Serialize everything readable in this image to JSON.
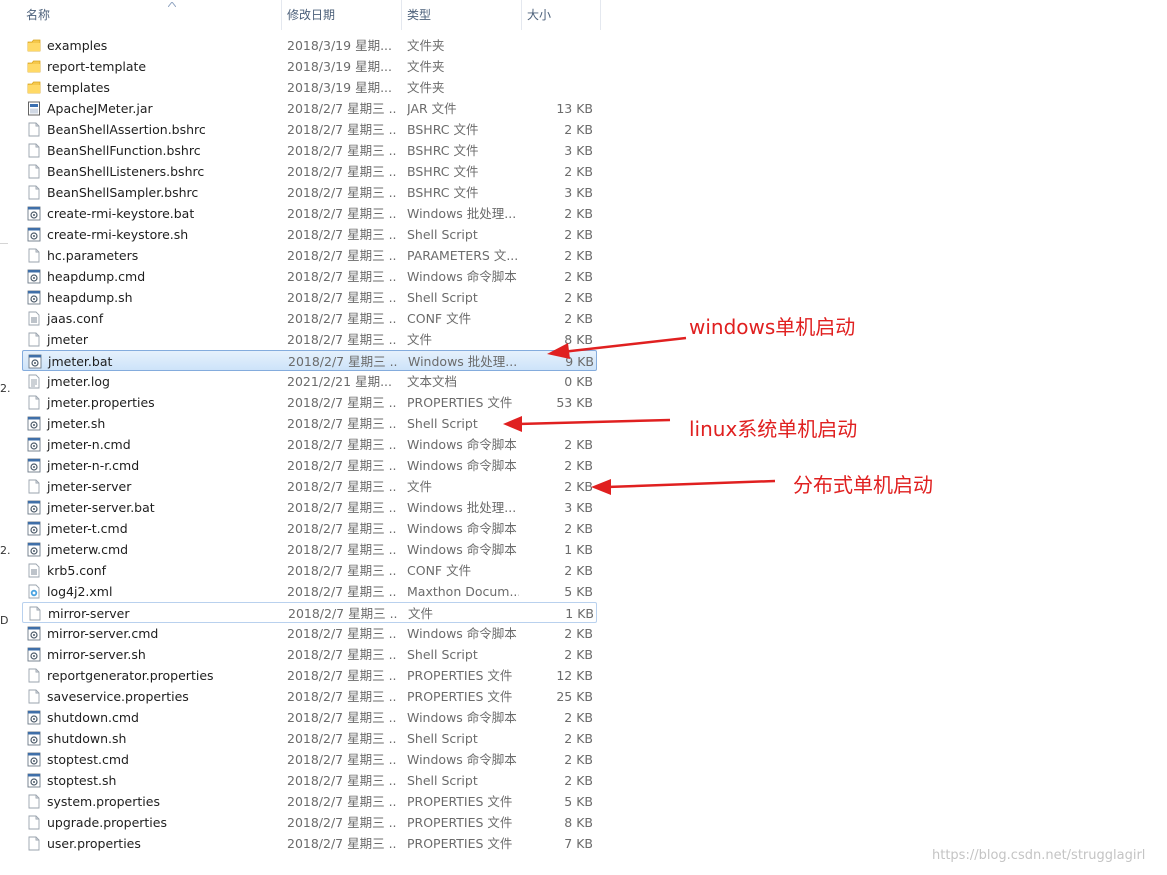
{
  "header": {
    "name": "名称",
    "date": "修改日期",
    "type": "类型",
    "size": "大小"
  },
  "gutter": [
    "2.",
    "2.",
    "D"
  ],
  "files": [
    {
      "name": "examples",
      "date": "2018/3/19 星期...",
      "type": "文件夹",
      "size": "",
      "icon": "folder-icon"
    },
    {
      "name": "report-template",
      "date": "2018/3/19 星期...",
      "type": "文件夹",
      "size": "",
      "icon": "folder-icon"
    },
    {
      "name": "templates",
      "date": "2018/3/19 星期...",
      "type": "文件夹",
      "size": "",
      "icon": "folder-icon"
    },
    {
      "name": "ApacheJMeter.jar",
      "date": "2018/2/7 星期三 ...",
      "type": "JAR 文件",
      "size": "13 KB",
      "icon": "jar-file-icon"
    },
    {
      "name": "BeanShellAssertion.bshrc",
      "date": "2018/2/7 星期三 ...",
      "type": "BSHRC 文件",
      "size": "2 KB",
      "icon": "file-icon"
    },
    {
      "name": "BeanShellFunction.bshrc",
      "date": "2018/2/7 星期三 ...",
      "type": "BSHRC 文件",
      "size": "3 KB",
      "icon": "file-icon"
    },
    {
      "name": "BeanShellListeners.bshrc",
      "date": "2018/2/7 星期三 ...",
      "type": "BSHRC 文件",
      "size": "2 KB",
      "icon": "file-icon"
    },
    {
      "name": "BeanShellSampler.bshrc",
      "date": "2018/2/7 星期三 ...",
      "type": "BSHRC 文件",
      "size": "3 KB",
      "icon": "file-icon"
    },
    {
      "name": "create-rmi-keystore.bat",
      "date": "2018/2/7 星期三 ...",
      "type": "Windows 批处理...",
      "size": "2 KB",
      "icon": "script-gear-icon"
    },
    {
      "name": "create-rmi-keystore.sh",
      "date": "2018/2/7 星期三 ...",
      "type": "Shell Script",
      "size": "2 KB",
      "icon": "script-gear-icon"
    },
    {
      "name": "hc.parameters",
      "date": "2018/2/7 星期三 ...",
      "type": "PARAMETERS 文...",
      "size": "2 KB",
      "icon": "file-icon"
    },
    {
      "name": "heapdump.cmd",
      "date": "2018/2/7 星期三 ...",
      "type": "Windows 命令脚本",
      "size": "2 KB",
      "icon": "script-gear-icon"
    },
    {
      "name": "heapdump.sh",
      "date": "2018/2/7 星期三 ...",
      "type": "Shell Script",
      "size": "2 KB",
      "icon": "script-gear-icon"
    },
    {
      "name": "jaas.conf",
      "date": "2018/2/7 星期三 ...",
      "type": "CONF 文件",
      "size": "2 KB",
      "icon": "config-file-icon"
    },
    {
      "name": "jmeter",
      "date": "2018/2/7 星期三 ...",
      "type": "文件",
      "size": "8 KB",
      "icon": "file-icon"
    },
    {
      "name": "jmeter.bat",
      "date": "2018/2/7 星期三 ...",
      "type": "Windows 批处理...",
      "size": "9 KB",
      "icon": "script-gear-icon",
      "state": "selected"
    },
    {
      "name": "jmeter.log",
      "date": "2021/2/21 星期...",
      "type": "文本文档",
      "size": "0 KB",
      "icon": "text-file-icon"
    },
    {
      "name": "jmeter.properties",
      "date": "2018/2/7 星期三 ...",
      "type": "PROPERTIES 文件",
      "size": "53 KB",
      "icon": "file-icon"
    },
    {
      "name": "jmeter.sh",
      "date": "2018/2/7 星期三 ...",
      "type": "Shell Script",
      "size": "",
      "icon": "script-gear-icon"
    },
    {
      "name": "jmeter-n.cmd",
      "date": "2018/2/7 星期三 ...",
      "type": "Windows 命令脚本",
      "size": "2 KB",
      "icon": "script-gear-icon"
    },
    {
      "name": "jmeter-n-r.cmd",
      "date": "2018/2/7 星期三 ...",
      "type": "Windows 命令脚本",
      "size": "2 KB",
      "icon": "script-gear-icon"
    },
    {
      "name": "jmeter-server",
      "date": "2018/2/7 星期三 ...",
      "type": "文件",
      "size": "2 KB",
      "icon": "file-icon"
    },
    {
      "name": "jmeter-server.bat",
      "date": "2018/2/7 星期三 ...",
      "type": "Windows 批处理...",
      "size": "3 KB",
      "icon": "script-gear-icon"
    },
    {
      "name": "jmeter-t.cmd",
      "date": "2018/2/7 星期三 ...",
      "type": "Windows 命令脚本",
      "size": "2 KB",
      "icon": "script-gear-icon"
    },
    {
      "name": "jmeterw.cmd",
      "date": "2018/2/7 星期三 ...",
      "type": "Windows 命令脚本",
      "size": "1 KB",
      "icon": "script-gear-icon"
    },
    {
      "name": "krb5.conf",
      "date": "2018/2/7 星期三 ...",
      "type": "CONF 文件",
      "size": "2 KB",
      "icon": "config-file-icon"
    },
    {
      "name": "log4j2.xml",
      "date": "2018/2/7 星期三 ...",
      "type": "Maxthon Docum...",
      "size": "5 KB",
      "icon": "xml-file-icon"
    },
    {
      "name": "mirror-server",
      "date": "2018/2/7 星期三 ...",
      "type": "文件",
      "size": "1 KB",
      "icon": "file-icon",
      "state": "focused"
    },
    {
      "name": "mirror-server.cmd",
      "date": "2018/2/7 星期三 ...",
      "type": "Windows 命令脚本",
      "size": "2 KB",
      "icon": "script-gear-icon"
    },
    {
      "name": "mirror-server.sh",
      "date": "2018/2/7 星期三 ...",
      "type": "Shell Script",
      "size": "2 KB",
      "icon": "script-gear-icon"
    },
    {
      "name": "reportgenerator.properties",
      "date": "2018/2/7 星期三 ...",
      "type": "PROPERTIES 文件",
      "size": "12 KB",
      "icon": "file-icon"
    },
    {
      "name": "saveservice.properties",
      "date": "2018/2/7 星期三 ...",
      "type": "PROPERTIES 文件",
      "size": "25 KB",
      "icon": "file-icon"
    },
    {
      "name": "shutdown.cmd",
      "date": "2018/2/7 星期三 ...",
      "type": "Windows 命令脚本",
      "size": "2 KB",
      "icon": "script-gear-icon"
    },
    {
      "name": "shutdown.sh",
      "date": "2018/2/7 星期三 ...",
      "type": "Shell Script",
      "size": "2 KB",
      "icon": "script-gear-icon"
    },
    {
      "name": "stoptest.cmd",
      "date": "2018/2/7 星期三 ...",
      "type": "Windows 命令脚本",
      "size": "2 KB",
      "icon": "script-gear-icon"
    },
    {
      "name": "stoptest.sh",
      "date": "2018/2/7 星期三 ...",
      "type": "Shell Script",
      "size": "2 KB",
      "icon": "script-gear-icon"
    },
    {
      "name": "system.properties",
      "date": "2018/2/7 星期三 ...",
      "type": "PROPERTIES 文件",
      "size": "5 KB",
      "icon": "file-icon"
    },
    {
      "name": "upgrade.properties",
      "date": "2018/2/7 星期三 ...",
      "type": "PROPERTIES 文件",
      "size": "8 KB",
      "icon": "file-icon"
    },
    {
      "name": "user.properties",
      "date": "2018/2/7 星期三 ...",
      "type": "PROPERTIES 文件",
      "size": "7 KB",
      "icon": "file-icon"
    }
  ],
  "annotations": {
    "windows": "windows单机启动",
    "linux": "linux系统单机启动",
    "distributed": "分布式单机启动",
    "color": "#e02020"
  },
  "watermark": "https://blog.csdn.net/strugglagirl",
  "colors": {
    "selection": "#cde3f9",
    "selection_border": "#84acdd",
    "header_text": "#4c607a",
    "secondary_text": "#6b6b6b"
  }
}
